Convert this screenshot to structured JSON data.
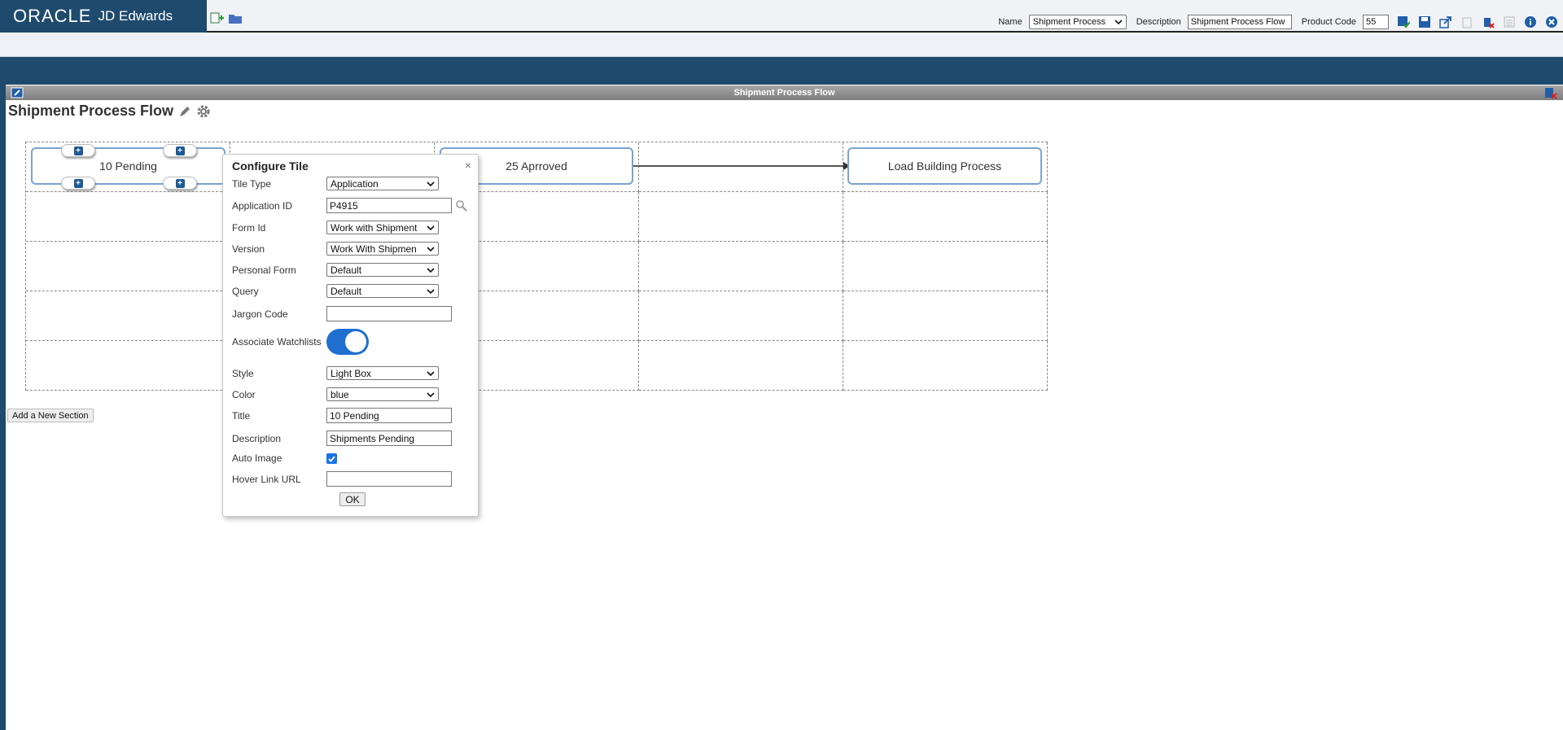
{
  "brand": {
    "oracle": "ORACLE",
    "product": "JD Edwards"
  },
  "toolbar": {
    "name_label": "Name",
    "name_value": "Shipment Process",
    "description_label": "Description",
    "description_value": "Shipment Process Flow",
    "product_code_label": "Product Code",
    "product_code_value": "55"
  },
  "panel": {
    "title": "Shipment Process Flow"
  },
  "page": {
    "heading": "Shipment Process Flow"
  },
  "tiles": [
    {
      "label": "10 Pending"
    },
    {
      "label": "25 Aprroved"
    },
    {
      "label": "Load Building Process"
    }
  ],
  "add_section_label": "Add a New Section",
  "dialog": {
    "title": "Configure Tile",
    "close": "×",
    "tile_type": {
      "label": "Tile Type",
      "value": "Application"
    },
    "application_id": {
      "label": "Application ID",
      "value": "P4915"
    },
    "form_id": {
      "label": "Form Id",
      "value": "Work with Shipment"
    },
    "version": {
      "label": "Version",
      "value": "Work With Shipmen"
    },
    "personal_form": {
      "label": "Personal Form",
      "value": "Default"
    },
    "query": {
      "label": "Query",
      "value": "Default"
    },
    "jargon_code": {
      "label": "Jargon Code",
      "value": ""
    },
    "associate_watchlists": {
      "label": "Associate Watchlists",
      "on": true
    },
    "style": {
      "label": "Style",
      "value": "Light Box"
    },
    "color": {
      "label": "Color",
      "value": "blue"
    },
    "tile_title": {
      "label": "Title",
      "value": "10 Pending"
    },
    "description": {
      "label": "Description",
      "value": "Shipments Pending"
    },
    "auto_image": {
      "label": "Auto Image",
      "checked": true
    },
    "hover_link_url": {
      "label": "Hover Link URL",
      "value": ""
    },
    "ok": "OK"
  }
}
